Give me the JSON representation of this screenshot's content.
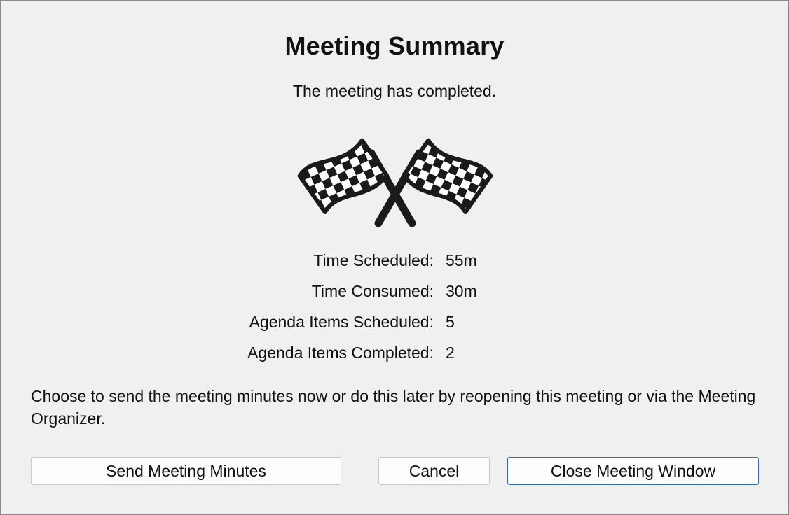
{
  "dialog": {
    "title": "Meeting Summary",
    "subtitle": "The meeting has completed.",
    "image_icon": "checkered-flags-icon",
    "stats": [
      {
        "label": "Time Scheduled:",
        "value": "55m"
      },
      {
        "label": "Time Consumed:",
        "value": "30m"
      },
      {
        "label": "Agenda Items Scheduled:",
        "value": "5"
      },
      {
        "label": "Agenda Items Completed:",
        "value": "2"
      }
    ],
    "message": "Choose to send the meeting minutes now or do this later by reopening this meeting or via the Meeting Organizer.",
    "buttons": {
      "send": "Send Meeting Minutes",
      "cancel": "Cancel",
      "close": "Close Meeting Window"
    }
  },
  "colors": {
    "background": "#f0f0f0",
    "text": "#111111",
    "default_button_border": "#2f6fb3"
  }
}
